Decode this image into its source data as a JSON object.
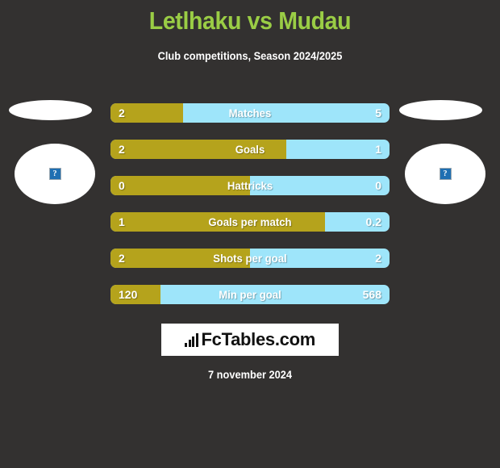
{
  "header": {
    "title": "Letlhaku vs Mudau",
    "subtitle": "Club competitions, Season 2024/2025",
    "title_color": "#9ACD45"
  },
  "theme": {
    "background": "#333130",
    "home_color": "#B5A31C",
    "away_color": "#9EE5FA",
    "text_color": "#FFFFFF"
  },
  "players": {
    "home": {
      "avatar_icon": "broken-image-icon",
      "placeholder_glyph": "?"
    },
    "away": {
      "avatar_icon": "broken-image-icon",
      "placeholder_glyph": "?"
    }
  },
  "chart_data": {
    "type": "bar",
    "title": "Letlhaku vs Mudau",
    "subtitle": "Club competitions, Season 2024/2025",
    "orientation": "horizontal-diverging",
    "series": [
      {
        "name": "Letlhaku",
        "color": "#B5A31C",
        "values": [
          2,
          2,
          0,
          1,
          2,
          120
        ]
      },
      {
        "name": "Mudau",
        "color": "#9EE5FA",
        "values": [
          5,
          1,
          0,
          0.2,
          2,
          568
        ]
      }
    ],
    "categories": [
      "Matches",
      "Goals",
      "Hattricks",
      "Goals per match",
      "Shots per goal",
      "Min per goal"
    ],
    "rows": [
      {
        "label": "Matches",
        "home": "2",
        "away": "5",
        "home_pct": 26
      },
      {
        "label": "Goals",
        "home": "2",
        "away": "1",
        "home_pct": 63
      },
      {
        "label": "Hattricks",
        "home": "0",
        "away": "0",
        "home_pct": 50
      },
      {
        "label": "Goals per match",
        "home": "1",
        "away": "0.2",
        "home_pct": 77
      },
      {
        "label": "Shots per goal",
        "home": "2",
        "away": "2",
        "home_pct": 50
      },
      {
        "label": "Min per goal",
        "home": "120",
        "away": "568",
        "home_pct": 18
      }
    ],
    "grid": false,
    "legend": "none"
  },
  "footer": {
    "logo_text": "FcTables.com",
    "logo_icon": "bar-chart-icon",
    "date": "7 november 2024"
  }
}
